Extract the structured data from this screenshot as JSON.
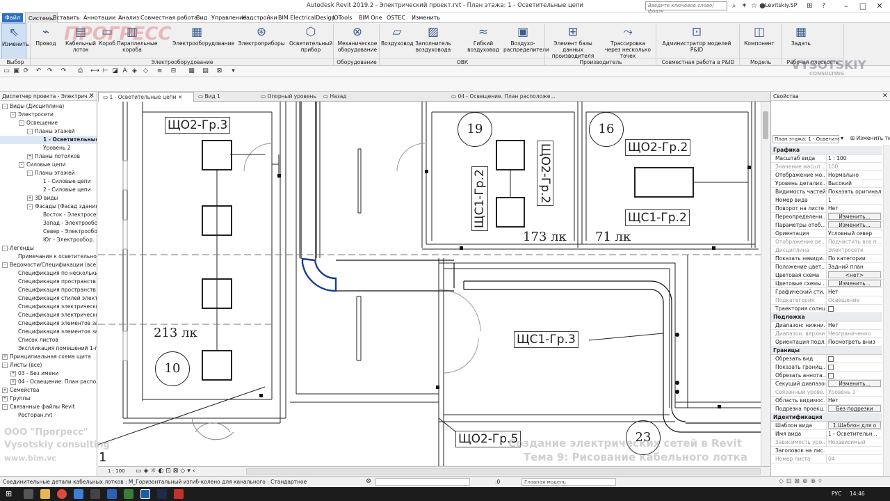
{
  "app": {
    "title": "Autodesk Revit 2019.2 - Электрический проект.rvt - План этажа: 1 - Осветительные цепи",
    "search_placeholder": "Введите ключевое слово/фразу",
    "user": "Levitskiy.SP"
  },
  "menu": [
    "Файл",
    "Системы",
    "Вставить",
    "Аннотации",
    "Анализ",
    "Совместная работа",
    "Вид",
    "Управление",
    "Надстройки",
    "BIM ElectricalDesign",
    "JOTools",
    "BIM One",
    "OSTEC",
    "Изменить"
  ],
  "ribbon": {
    "buttons": [
      {
        "label": "Изменить",
        "icon": "cursor-icon"
      },
      {
        "label": "Провод",
        "icon": "wire-icon"
      },
      {
        "label": "Кабельный лоток",
        "icon": "cable-tray-icon"
      },
      {
        "label": "Короб",
        "icon": "conduit-icon"
      },
      {
        "label": "Параллельные короба",
        "icon": "parallel-conduits-icon"
      },
      {
        "label": "Электрооборудование",
        "icon": "electrical-equipment-icon"
      },
      {
        "label": "Электроприборы",
        "icon": "electrical-fixture-icon"
      },
      {
        "label": "Осветительный прибор",
        "icon": "lighting-fixture-icon"
      },
      {
        "label": "Механическое оборудование",
        "icon": "mechanical-equipment-icon"
      },
      {
        "label": "Воздуховод",
        "icon": "duct-icon"
      },
      {
        "label": "Заполнитель воздуховода",
        "icon": "duct-placeholder-icon"
      },
      {
        "label": "Гибкий воздуховод",
        "icon": "flex-duct-icon"
      },
      {
        "label": "Воздухо-распределители",
        "icon": "air-terminal-icon"
      },
      {
        "label": "Элемент базы данных производителя",
        "icon": "manufacturer-db-icon"
      },
      {
        "label": "Трассировка через несколько точек",
        "icon": "multipoint-routing-icon"
      },
      {
        "label": "Администратор моделей P&ID",
        "icon": "pid-admin-icon"
      },
      {
        "label": "Компонент",
        "icon": "component-icon"
      },
      {
        "label": "Задать",
        "icon": "workplane-set-icon"
      }
    ],
    "groups": [
      "Выбор",
      "Электрооборудование",
      "Оборудование",
      "ОВК",
      "Производитель",
      "Совместная работа в P&ID",
      "Модель",
      "Рабочая плоскость"
    ]
  },
  "project_browser": {
    "title": "Диспетчер проекта - Электрич...",
    "items": [
      {
        "label": "Виды (Дисциплина)",
        "level": 0,
        "toggle": "-"
      },
      {
        "label": "Электросети",
        "level": 1,
        "toggle": "-"
      },
      {
        "label": "Освещение",
        "level": 2,
        "toggle": "-"
      },
      {
        "label": "Планы этажей",
        "level": 3,
        "toggle": "-"
      },
      {
        "label": "1 - Осветительные цепи",
        "level": 4,
        "toggle": "",
        "selected": true
      },
      {
        "label": "Уровень 2",
        "level": 4,
        "toggle": ""
      },
      {
        "label": "Планы потолков",
        "level": 3,
        "toggle": "+"
      },
      {
        "label": "Силовые цепи",
        "level": 2,
        "toggle": "-"
      },
      {
        "label": "Планы этажей",
        "level": 3,
        "toggle": "-"
      },
      {
        "label": "1 - Силовые цепи",
        "level": 4,
        "toggle": ""
      },
      {
        "label": "2 - Силовые цепи",
        "level": 4,
        "toggle": ""
      },
      {
        "label": "3D виды",
        "level": 3,
        "toggle": "+"
      },
      {
        "label": "Фасады (Фасад здания)",
        "level": 3,
        "toggle": "-"
      },
      {
        "label": "Восток - Электросети",
        "level": 4,
        "toggle": ""
      },
      {
        "label": "Запад - Электрообор.",
        "level": 4,
        "toggle": ""
      },
      {
        "label": "Север - Электрообор.",
        "level": 4,
        "toggle": ""
      },
      {
        "label": "Юг - Электрообор.",
        "level": 4,
        "toggle": ""
      },
      {
        "label": "Легенды",
        "level": 0,
        "toggle": "-"
      },
      {
        "label": "Примечания к осветительной",
        "level": 1,
        "toggle": ""
      },
      {
        "label": "Ведомости/Спецификации (все)",
        "level": 0,
        "toggle": "-"
      },
      {
        "label": "Спецификация по нескольким",
        "level": 1,
        "toggle": ""
      },
      {
        "label": "Спецификация пространств",
        "level": 1,
        "toggle": ""
      },
      {
        "label": "Спецификация пространств Т",
        "level": 1,
        "toggle": ""
      },
      {
        "label": "Спецификация стилей электр",
        "level": 1,
        "toggle": ""
      },
      {
        "label": "Спецификация электрических",
        "level": 1,
        "toggle": ""
      },
      {
        "label": "Спецификация электрически",
        "level": 1,
        "toggle": ""
      },
      {
        "label": "Спецификация элементов заг",
        "level": 1,
        "toggle": ""
      },
      {
        "label": "Спецификация элементов заг",
        "level": 1,
        "toggle": ""
      },
      {
        "label": "Список листов",
        "level": 1,
        "toggle": ""
      },
      {
        "label": "Экспликация помещений 1-г",
        "level": 1,
        "toggle": ""
      },
      {
        "label": "Принципиальная схема щита",
        "level": 0,
        "toggle": "+"
      },
      {
        "label": "Листы (все)",
        "level": 0,
        "toggle": "-"
      },
      {
        "label": "03 - Без имени",
        "level": 1,
        "toggle": "+"
      },
      {
        "label": "04 - Освещение. План распол",
        "level": 1,
        "toggle": "+"
      },
      {
        "label": "Семейства",
        "level": 0,
        "toggle": "+"
      },
      {
        "label": "Группы",
        "level": 0,
        "toggle": "+"
      },
      {
        "label": "Связанные файлы Revit",
        "level": 0,
        "toggle": "-"
      },
      {
        "label": "Ресторан.rvt",
        "level": 1,
        "toggle": ""
      }
    ]
  },
  "tabs": [
    "1 - Осветительные цепи",
    "Вид 1",
    "Опорный уровень",
    "Назад",
    "04 - Освещение. План расположе..."
  ],
  "drawing": {
    "tags": [
      "ЩО2-Гр.3",
      "ЩС1-Гр.2",
      "ЩО2-Гр.2",
      "ЩО2-Гр.2",
      "ЩС1-Гр.2",
      "ЩС1-Гр.3",
      "ЩО2-Гр.5"
    ],
    "lux": [
      "213 лк",
      "173 лк",
      "71 лк"
    ],
    "rooms": [
      "19",
      "16",
      "10",
      "23"
    ],
    "level_mark": "1",
    "scale": "1 : 100"
  },
  "properties": {
    "title": "Свойства",
    "type_selector": "План этажа: 1 - Осветите",
    "edit_type": "Изменить тип",
    "sections": [
      {
        "name": "Графика",
        "rows": [
          [
            "Масштаб вида",
            "1 : 100",
            ""
          ],
          [
            "Значение масшт...",
            "100",
            "dim"
          ],
          [
            "Отображение мо...",
            "Нормально",
            ""
          ],
          [
            "Уровень детализ...",
            "Высокий",
            ""
          ],
          [
            "Видимость частей",
            "Показать оригинал",
            ""
          ],
          [
            "Номер вида",
            "1",
            ""
          ],
          [
            "Поворот на листе",
            "Нет",
            ""
          ],
          [
            "Переопределени...",
            "Изменить...",
            "btn"
          ],
          [
            "Параметры отоб...",
            "Изменить...",
            "btn"
          ],
          [
            "Ориентация",
            "Условный север",
            ""
          ],
          [
            "Отображение ре...",
            "Подчистить все п...",
            "dim"
          ],
          [
            "Дисциплина",
            "Электросети",
            "dim"
          ],
          [
            "Показать невиди...",
            "По категории",
            ""
          ],
          [
            "Положение цвет...",
            "Задний план",
            ""
          ],
          [
            "Цветовая схема",
            "<нет>",
            "btn"
          ],
          [
            "Цветовые схемы ...",
            "Изменить...",
            "btn"
          ],
          [
            "Графический сти...",
            "Нет",
            ""
          ],
          [
            "Подкатегория",
            "Освещение",
            "dim"
          ],
          [
            "Траектория солнца",
            "",
            "chk"
          ]
        ]
      },
      {
        "name": "Подложка",
        "rows": [
          [
            "Диапазон: нижни...",
            "Нет",
            ""
          ],
          [
            "Диапазон: верхни...",
            "Неограниченно",
            "dim"
          ],
          [
            "Ориентация подл...",
            "Посмотреть вниз",
            ""
          ]
        ]
      },
      {
        "name": "Границы",
        "rows": [
          [
            "Обрезать вид",
            "",
            "chk"
          ],
          [
            "Показать границ...",
            "",
            "chk"
          ],
          [
            "Обрезать аннота...",
            "",
            "chk"
          ],
          [
            "Секущий диапазон",
            "Изменить...",
            "btn"
          ],
          [
            "Связанный урове...",
            "Уровень 1",
            "dim"
          ],
          [
            "Область видимос...",
            "Нет",
            ""
          ],
          [
            "Подрезка проекц...",
            "Без подрезки",
            "btn"
          ]
        ]
      },
      {
        "name": "Идентификация",
        "rows": [
          [
            "Шаблон вида",
            "1.Шаблон для о",
            "btn"
          ],
          [
            "Имя вида",
            "1 - Осветительн...",
            ""
          ],
          [
            "Зависимость уро...",
            "Независимый",
            "dim"
          ],
          [
            "Заголовок на лис...",
            "",
            ""
          ],
          [
            "Номер листа",
            "04",
            "dim"
          ]
        ]
      }
    ]
  },
  "status": {
    "text": "Соединительные детали кабельных лотков : M_Горизонтальный изгиб-колено для канального : Стандартное",
    "model": "Главная модель",
    "zoom": ":0"
  },
  "watermark": {
    "company1": "ООО \"Прогресс\"",
    "company2": "Vysotskiy consulting",
    "site": "www.bim.vc",
    "course1": "Создание электрических сетей в Revit",
    "course2": "Тема 9: Рисование кабельного лотка",
    "logo1": "ПРОГРЕСС",
    "logo2": "VYSOTSKIY",
    "logo3": "CONSULTING"
  },
  "taskbar": {
    "lang": "РУС",
    "time": "14:46"
  }
}
